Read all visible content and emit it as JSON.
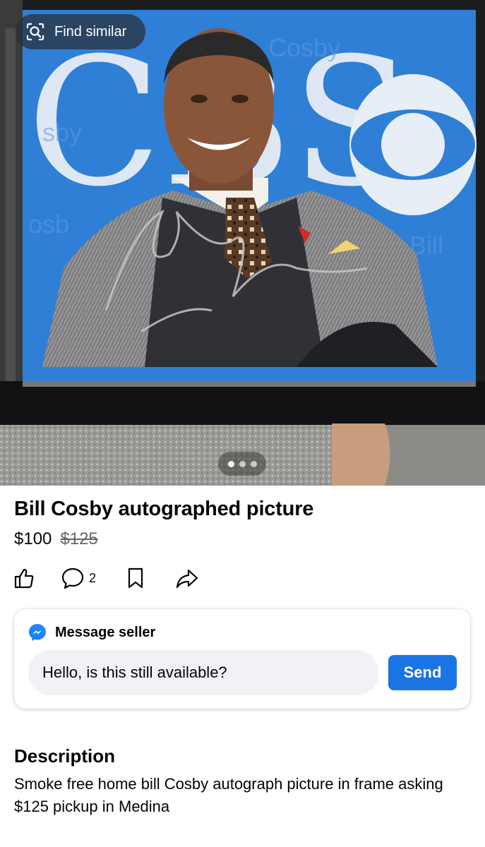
{
  "photo": {
    "find_similar_label": "Find similar",
    "find_similar_icon": "visual-search-icon",
    "backdrop_text": "CBS",
    "carousel_total": 3,
    "carousel_active": 1
  },
  "listing": {
    "title": "Bill Cosby autographed picture",
    "price": "$100",
    "original_price": "$125",
    "comment_count": "2"
  },
  "actions": [
    {
      "name": "like",
      "icon": "thumbs-up-icon"
    },
    {
      "name": "comment",
      "icon": "comment-bubble-icon"
    },
    {
      "name": "save",
      "icon": "bookmark-icon"
    },
    {
      "name": "share",
      "icon": "share-arrow-icon"
    }
  ],
  "message": {
    "heading": "Message seller",
    "icon": "messenger-icon",
    "input_value": "Hello, is this still available?",
    "send_label": "Send"
  },
  "description": {
    "heading": "Description",
    "text": "Smoke free home bill Cosby autograph picture in frame asking $125 pickup in Medina"
  },
  "colors": {
    "accent": "#1b74e4",
    "backdrop_blue": "#2f7fd6",
    "input_bg": "#f0f2f5",
    "muted_text": "#65676b"
  }
}
